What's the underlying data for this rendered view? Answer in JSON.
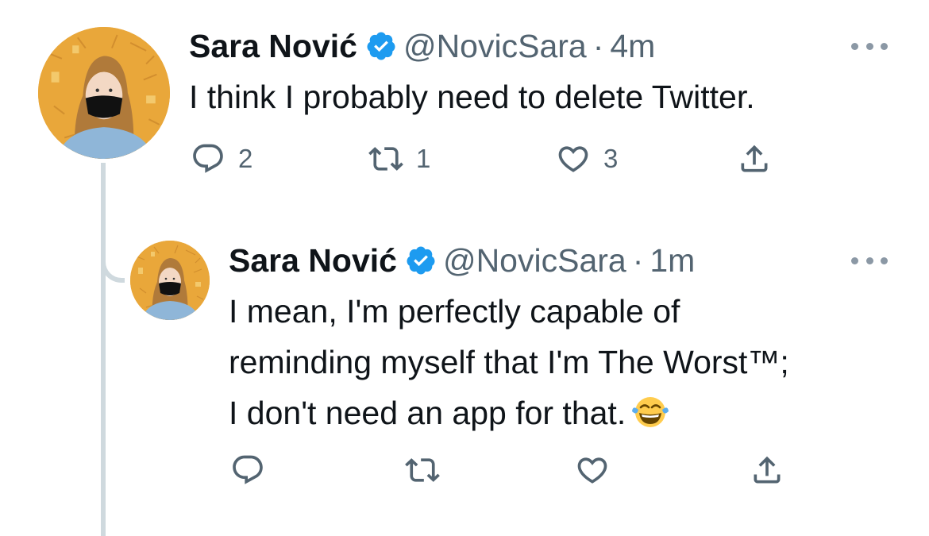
{
  "thread": {
    "main_tweet": {
      "display_name": "Sara Nović",
      "handle": "@NovicSara",
      "separator": "·",
      "time": "4m",
      "text": "I think I probably need to delete Twitter.",
      "reply_count": "2",
      "retweet_count": "1",
      "like_count": "3"
    },
    "reply_tweet": {
      "display_name": "Sara Nović",
      "handle": "@NovicSara",
      "separator": "·",
      "time": "1m",
      "text": "I mean, I'm perfectly capable of reminding myself that I'm The Worst™; I don't need an app for that.",
      "emoji": "face-with-tears-of-joy"
    }
  },
  "colors": {
    "text": "#0f1419",
    "muted": "#536471",
    "verified": "#1d9bf0",
    "thread_line": "#cfd9de"
  }
}
